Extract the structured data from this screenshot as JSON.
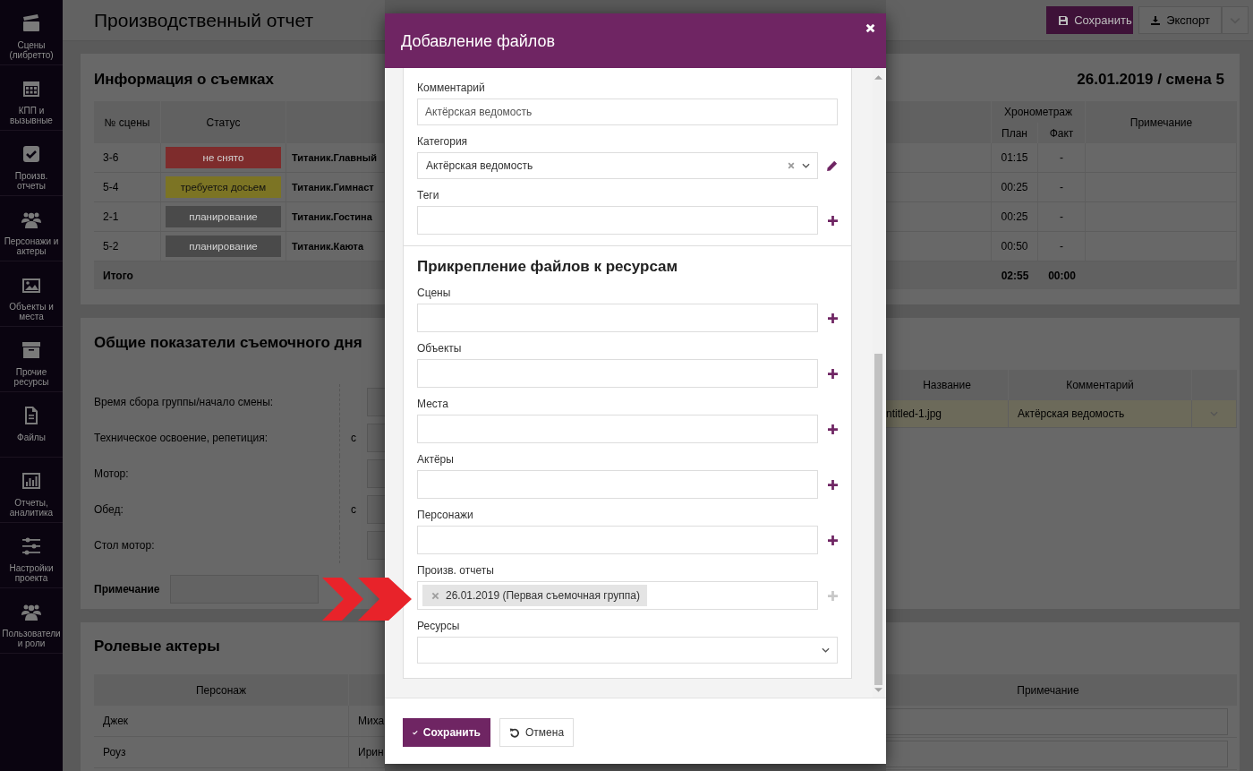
{
  "sidebar": {
    "items": [
      {
        "label": "Сцены (либретто)"
      },
      {
        "label": "КПП и вызывные"
      },
      {
        "label": "Произв. отчеты"
      },
      {
        "label": "Персонажи и актеры"
      },
      {
        "label": "Объекты и места"
      },
      {
        "label": "Прочие ресурсы"
      },
      {
        "label": "Файлы"
      },
      {
        "label": "Отчеты, аналитика"
      },
      {
        "label": "Настройки проекта"
      },
      {
        "label": "Пользователи и роли"
      }
    ]
  },
  "page": {
    "title": "Производственный отчет",
    "actions": [
      {
        "kind": "save",
        "label": "Сохранить"
      },
      {
        "kind": "export",
        "label": "Экспорт"
      },
      {
        "kind": "menu"
      }
    ]
  },
  "shooting_info": {
    "title": "Информация о съемках",
    "date": "26.01.2019 / смена 5",
    "columns": [
      "№ сцены",
      "Статус"
    ],
    "timing_header": "Хронометраж",
    "timing_columns": [
      "План",
      "Факт"
    ],
    "note_column": "Примечание",
    "rows": [
      {
        "scene": "3-6",
        "status": "не снято",
        "color": "#7e2c2c",
        "scene_name": "Титаник.Главный",
        "plan": "01:15",
        "fact": "-"
      },
      {
        "scene": "5-4",
        "status": "требуется досьем",
        "color": "#7c7424",
        "scene_name": "Титаник.Гимнаст",
        "plan": "00:25",
        "fact": "-"
      },
      {
        "scene": "2-1",
        "status": "планирование",
        "color": "#4a4a4a",
        "scene_name": "Титаник.Гостина",
        "plan": "00:25",
        "fact": "-"
      },
      {
        "scene": "5-2",
        "status": "планирование",
        "color": "#4a4a4a",
        "scene_name": "Титаник.Каюта",
        "plan": "00:50",
        "fact": "-"
      }
    ],
    "total": {
      "label": "Итого",
      "plan": "02:55",
      "fact": "00:00"
    }
  },
  "day_summary": {
    "title": "Общие показатели съемочного дня",
    "rows": [
      {
        "label": "Время сбора группы/начало смены:"
      },
      {
        "label": "Техническое освоение, репетиция:",
        "prefix": "с"
      },
      {
        "label": "Мотор:"
      },
      {
        "label": "Обед:",
        "prefix": "с"
      },
      {
        "label": "Стол мотор:"
      }
    ],
    "note_label": "Примечание",
    "files": {
      "columns": [
        "Название",
        "Комментарий"
      ],
      "rows": [
        {
          "name": "ntitled-1.jpg",
          "comment": "Актёрская ведомость"
        }
      ]
    }
  },
  "role_actors": {
    "title": "Ролевые актеры",
    "columns": [
      "Персонаж"
    ],
    "note_column": "Примечание",
    "rows": [
      {
        "character": "Джек",
        "actor": "Миха"
      },
      {
        "character": "Роуз",
        "actor": "Ирин"
      }
    ]
  },
  "modal": {
    "title": "Добавление файлов",
    "fields": [
      {
        "kind": "input",
        "label": "Комментарий",
        "value": "Актёрская ведомость"
      },
      {
        "kind": "select",
        "label": "Категория",
        "value": "Актёрская ведомость",
        "clearable": true,
        "editable": true
      },
      {
        "kind": "picker",
        "label": "Теги",
        "disabled": false
      }
    ],
    "attach": {
      "title": "Прикрепление файлов к ресурсам",
      "fields": [
        {
          "kind": "picker",
          "label": "Сцены",
          "disabled": false
        },
        {
          "kind": "picker",
          "label": "Объекты",
          "disabled": false
        },
        {
          "kind": "picker",
          "label": "Места",
          "disabled": false
        },
        {
          "kind": "picker",
          "label": "Актёры",
          "disabled": false
        },
        {
          "kind": "picker",
          "label": "Персонажи",
          "disabled": false
        },
        {
          "kind": "picker",
          "label": "Произв. отчеты",
          "disabled": true,
          "tags": [
            "26.01.2019 (Первая съемочная группа)"
          ]
        },
        {
          "kind": "select",
          "label": "Ресурсы",
          "clearable": false,
          "editable": false
        }
      ]
    },
    "buttons": [
      {
        "kind": "primary",
        "label": "Сохранить"
      },
      {
        "kind": "cancel",
        "label": "Отмена"
      }
    ]
  }
}
